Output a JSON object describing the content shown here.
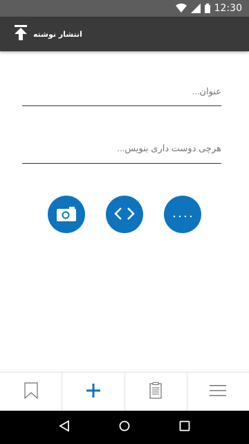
{
  "status_bar": {
    "time": "12:30"
  },
  "app_bar": {
    "title": "انتشار نوشته"
  },
  "form": {
    "title_placeholder": "عنوان...",
    "body_placeholder": "هرچی دوست داری بنویس..."
  },
  "actions": [
    {
      "icon": "camera-icon"
    },
    {
      "icon": "code-icon"
    },
    {
      "icon": "more-dots-icon"
    }
  ],
  "tab_bar": {
    "items": [
      {
        "icon": "bookmark-icon"
      },
      {
        "icon": "plus-icon"
      },
      {
        "icon": "clipboard-icon"
      },
      {
        "icon": "menu-icon"
      }
    ]
  },
  "colors": {
    "accent": "#0f74be",
    "app_bar": "#3a3a3a",
    "status_bar": "#5d5d5d"
  }
}
